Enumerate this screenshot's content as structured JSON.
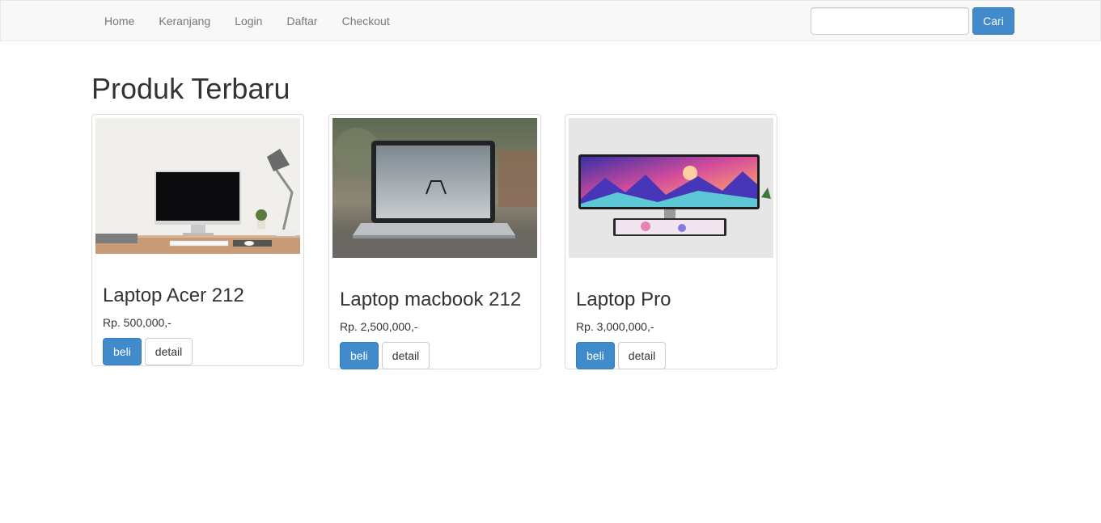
{
  "nav": {
    "items": [
      {
        "label": "Home"
      },
      {
        "label": "Keranjang"
      },
      {
        "label": "Login"
      },
      {
        "label": "Daftar"
      },
      {
        "label": "Checkout"
      }
    ],
    "search_placeholder": "",
    "search_button": "Cari"
  },
  "main": {
    "title": "Produk Terbaru",
    "products": [
      {
        "name": "Laptop Acer 212",
        "price": "Rp. 500,000,-",
        "buy_label": "beli",
        "detail_label": "detail",
        "image_icon": "imac-desk-photo"
      },
      {
        "name": "Laptop macbook 212",
        "price": "Rp. 2,500,000,-",
        "buy_label": "beli",
        "detail_label": "detail",
        "image_icon": "macbook-photo"
      },
      {
        "name": "Laptop Pro",
        "price": "Rp. 3,000,000,-",
        "buy_label": "beli",
        "detail_label": "detail",
        "image_icon": "ultrawide-monitor-photo"
      }
    ]
  },
  "colors": {
    "primary": "#428bca",
    "navbar_bg": "#f8f8f8",
    "nav_text": "#777777"
  }
}
